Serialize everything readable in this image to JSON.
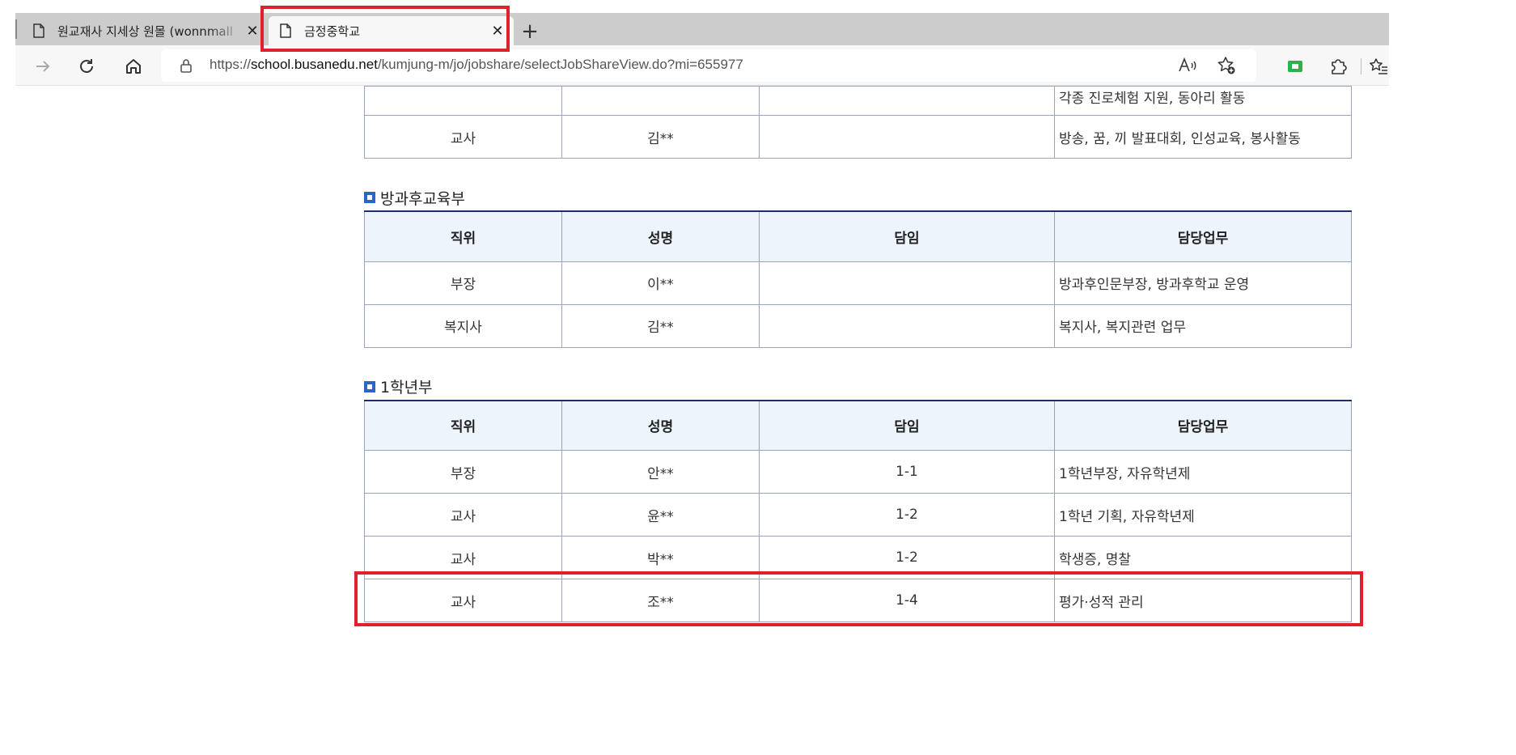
{
  "browser": {
    "tabs": [
      {
        "title": "원교재사 지세상 원몰 (wonnmall",
        "active": false
      },
      {
        "title": "금정중학교",
        "active": true
      }
    ],
    "url_prefix": "https://",
    "url_host": "school.busanedu.net",
    "url_path": "/kumjung-m/jo/jobshare/selectJobShareView.do?mi=655977",
    "highlight_color": "#e0202a"
  },
  "top_table": {
    "rows": [
      {
        "position": "",
        "name": "",
        "homeroom": "",
        "duty": "각종 진로체험 지원, 동아리 활동"
      },
      {
        "position": "교사",
        "name": "김**",
        "homeroom": "",
        "duty": "방송, 꿈, 끼 발표대회, 인성교육, 봉사활동"
      }
    ]
  },
  "headers": {
    "position": "직위",
    "name": "성명",
    "homeroom": "담임",
    "duty": "담당업무"
  },
  "sections": [
    {
      "title": "방과후교육부",
      "rows": [
        {
          "position": "부장",
          "name": "이**",
          "homeroom": "",
          "duty": "방과후인문부장, 방과후학교 운영"
        },
        {
          "position": "복지사",
          "name": "김**",
          "homeroom": "",
          "duty": "복지사, 복지관련 업무"
        }
      ]
    },
    {
      "title": "1학년부",
      "rows": [
        {
          "position": "부장",
          "name": "안**",
          "homeroom": "1-1",
          "duty": "1학년부장, 자유학년제"
        },
        {
          "position": "교사",
          "name": "윤**",
          "homeroom": "1-2",
          "duty": "1학년 기획, 자유학년제"
        },
        {
          "position": "교사",
          "name": "박**",
          "homeroom": "1-2",
          "duty": "학생증, 명찰"
        },
        {
          "position": "교사",
          "name": "조**",
          "homeroom": "1-4",
          "duty": "평가·성적 관리"
        }
      ]
    }
  ]
}
